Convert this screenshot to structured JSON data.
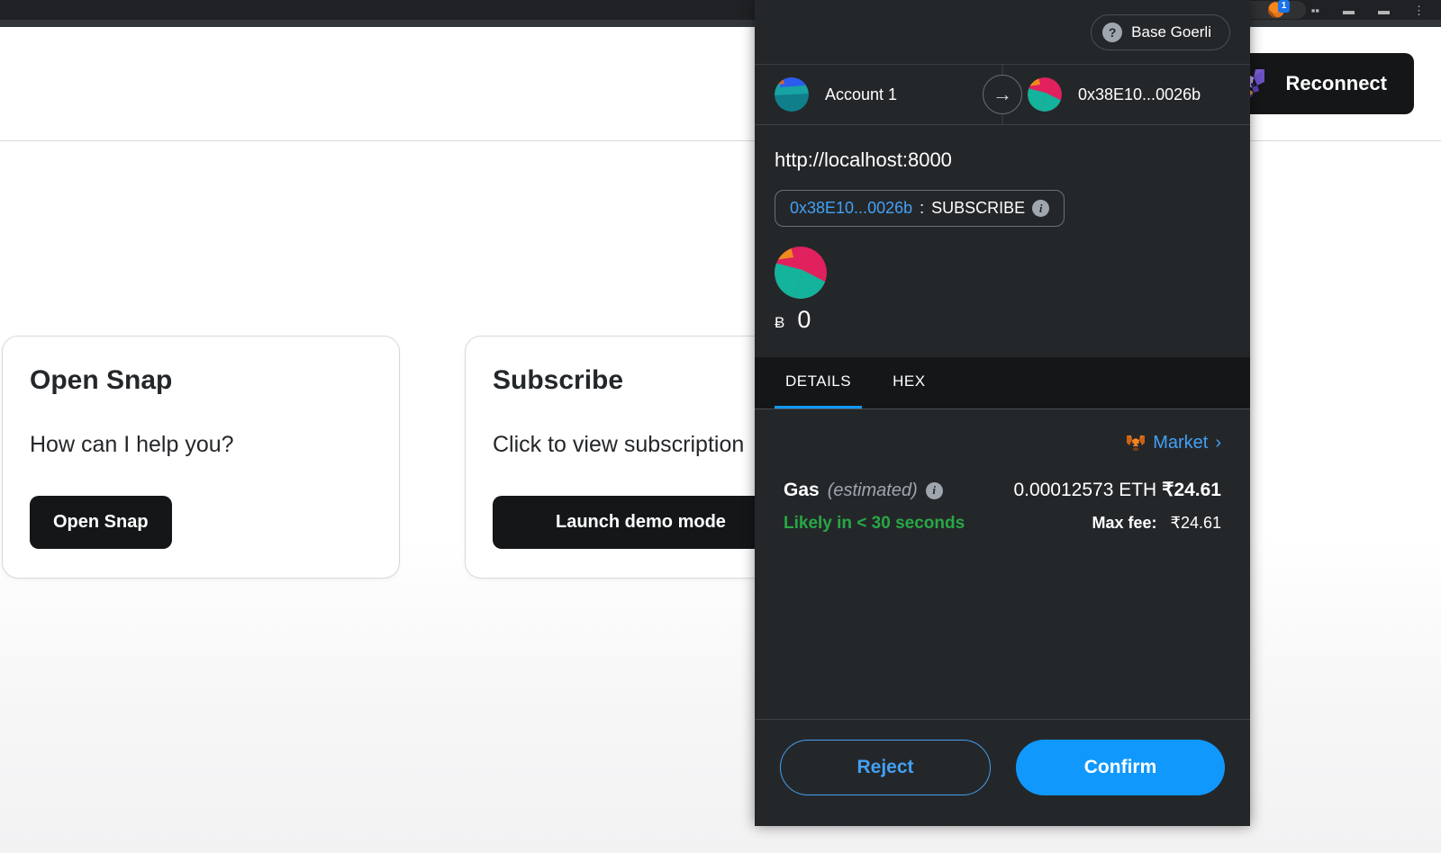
{
  "browser": {
    "extension_badge_count": "1",
    "icons": [
      "cast-icon",
      "share-icon",
      "metamask-extension-icon",
      "puzzle-icon",
      "profile-icon",
      "window-icon",
      "menu-icon"
    ]
  },
  "dapp": {
    "header": {
      "reconnect_label": "Reconnect"
    },
    "cards": [
      {
        "title": "Open Snap",
        "description": "How can I help you?",
        "button_label": "Open Snap"
      },
      {
        "title": "Subscribe",
        "description": "Click to view subscription",
        "button_label": "Launch demo mode"
      }
    ]
  },
  "metamask": {
    "network": {
      "label": "Base Goerli",
      "icon": "question-mark-icon"
    },
    "accounts": {
      "from_name": "Account 1",
      "to_address": "0x38E10...0026b",
      "arrow": "→"
    },
    "origin": "http://localhost:8000",
    "contract": {
      "address": "0x38E10...0026b",
      "separator": ":",
      "method": "SUBSCRIBE",
      "info": "i"
    },
    "amount": {
      "symbol": "Ƀ",
      "value": "0"
    },
    "tabs": [
      {
        "label": "DETAILS",
        "active": true
      },
      {
        "label": "HEX",
        "active": false
      }
    ],
    "details": {
      "market_label": "Market",
      "market_chevron": "›",
      "gas_label": "Gas",
      "gas_estimated": "(estimated)",
      "gas_info": "i",
      "gas_amount_eth": "0.00012573 ETH",
      "gas_amount_fiat": "₹24.61",
      "gas_speed": "Likely in < 30 seconds",
      "max_fee_label": "Max fee:",
      "max_fee_value": "₹24.61"
    },
    "footer": {
      "reject_label": "Reject",
      "confirm_label": "Confirm"
    },
    "colors": {
      "panel_bg": "#24272a",
      "tabs_bg": "#141618",
      "accent_blue": "#1098fc",
      "link_blue": "#43a0f5",
      "success_green": "#28a745"
    }
  }
}
